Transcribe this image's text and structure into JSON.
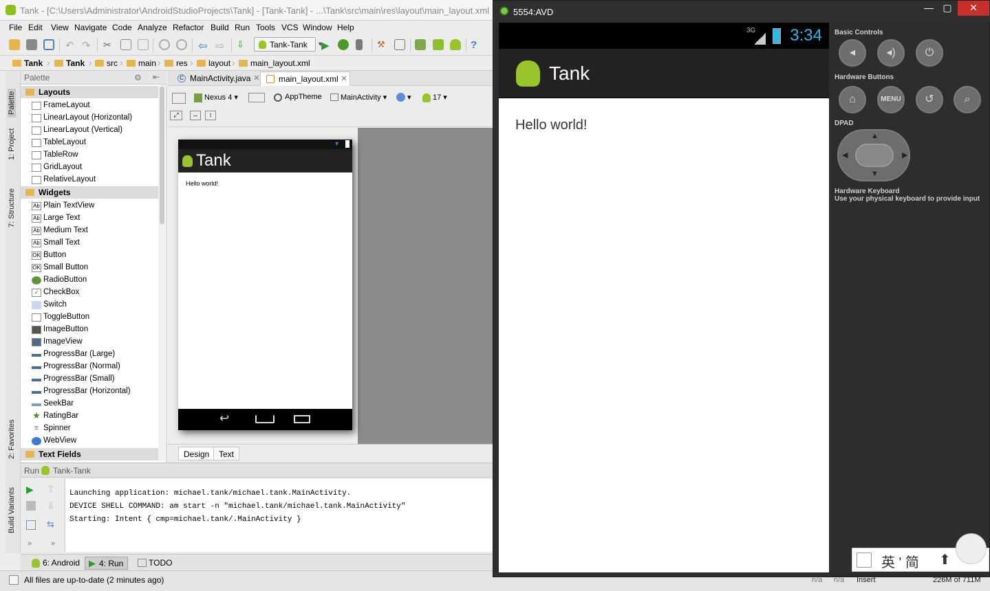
{
  "ide": {
    "window_title": "Tank - [C:\\Users\\Administrator\\AndroidStudioProjects\\Tank] - [Tank-Tank] - ...\\Tank\\src\\main\\res\\layout\\main_layout.xml",
    "menu": [
      "File",
      "Edit",
      "View",
      "Navigate",
      "Code",
      "Analyze",
      "Refactor",
      "Build",
      "Run",
      "Tools",
      "VCS",
      "Window",
      "Help"
    ],
    "run_config": "Tank-Tank",
    "breadcrumb": [
      "Tank",
      "Tank",
      "src",
      "main",
      "res",
      "layout",
      "main_layout.xml"
    ],
    "side_tabs": [
      "1: Project",
      "Palette",
      "7: Structure",
      "2: Favorites",
      "Build Variants"
    ],
    "palette": {
      "title": "Palette",
      "groups": [
        {
          "name": "Layouts",
          "items": [
            "FrameLayout",
            "LinearLayout (Horizontal)",
            "LinearLayout (Vertical)",
            "TableLayout",
            "TableRow",
            "GridLayout",
            "RelativeLayout"
          ]
        },
        {
          "name": "Widgets",
          "items": [
            "Plain TextView",
            "Large Text",
            "Medium Text",
            "Small Text",
            "Button",
            "Small Button",
            "RadioButton",
            "CheckBox",
            "Switch",
            "ToggleButton",
            "ImageButton",
            "ImageView",
            "ProgressBar (Large)",
            "ProgressBar (Normal)",
            "ProgressBar (Small)",
            "ProgressBar (Horizontal)",
            "SeekBar",
            "RatingBar",
            "Spinner",
            "WebView"
          ]
        },
        {
          "name": "Text Fields",
          "items": []
        }
      ]
    },
    "editor_tabs": [
      {
        "label": "MainActivity.java",
        "active": false
      },
      {
        "label": "main_layout.xml",
        "active": true
      }
    ],
    "design_toolbar": {
      "device": "Nexus 4",
      "theme": "AppTheme",
      "activity": "MainActivity",
      "api": "17"
    },
    "preview": {
      "app_title": "Tank",
      "body_text": "Hello world!"
    },
    "design_tabs": [
      "Design",
      "Text"
    ],
    "run_panel": {
      "label": "Run",
      "config": "Tank-Tank",
      "lines": [
        "Launching application: michael.tank/michael.tank.MainActivity.",
        "DEVICE SHELL COMMAND: am start -n \"michael.tank/michael.tank.MainActivity\"",
        "Starting: Intent { cmp=michael.tank/.MainActivity }"
      ]
    },
    "bottom_tabs": [
      {
        "label": "6: Android",
        "selected": false
      },
      {
        "label": "4: Run",
        "selected": true
      },
      {
        "label": "TODO",
        "selected": false
      }
    ],
    "status_message": "All files are up-to-date (2 minutes ago)",
    "status_right": {
      "a": "n/a",
      "b": "n/a",
      "mode": "Insert",
      "memory": "226M of 711M"
    }
  },
  "avd": {
    "window_title": "5554:AVD",
    "status_signal": "3G",
    "time": "3:34",
    "app_title": "Tank",
    "body_text": "Hello world!",
    "sections": {
      "basic": "Basic Controls",
      "hardware": "Hardware Buttons",
      "dpad": "DPAD",
      "keyboard_title": "Hardware Keyboard",
      "keyboard_desc": "Use your physical keyboard to provide input"
    },
    "menu_label": "MENU"
  },
  "ime": {
    "chars": "英 ' 简"
  },
  "colors": {
    "android_green": "#98c52a",
    "holo_blue": "#33b5e5",
    "close_red": "#c7302a"
  }
}
